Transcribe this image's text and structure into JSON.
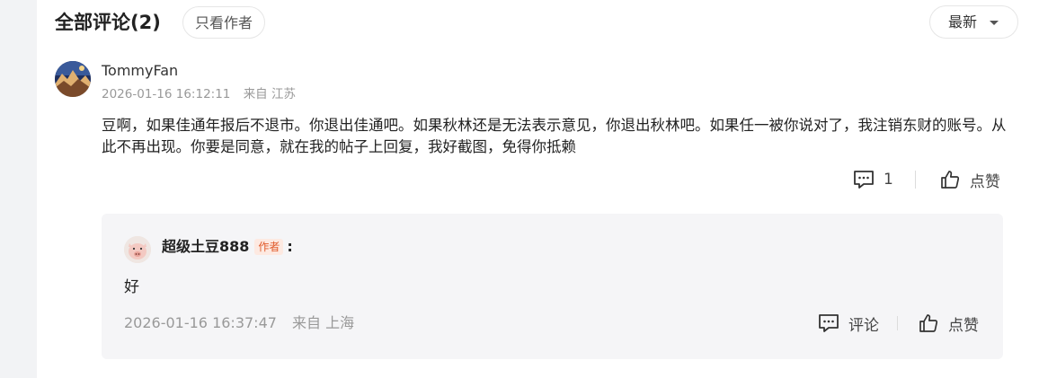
{
  "header": {
    "title": "全部评论(2)",
    "filter_label": "只看作者",
    "sort_label": "最新"
  },
  "comment": {
    "username": "TommyFan",
    "time": "2026-01-16 16:12:11",
    "location": "来自 江苏",
    "text": "豆啊，如果佳通年报后不退市。你退出佳通吧。如果秋林还是无法表示意见，你退出秋林吧。如果任一被你说对了，我注销东财的账号。从此不再出现。你要是同意，就在我的帖子上回复，我好截图，免得你抵赖",
    "reply_count": "1",
    "like_label": "点赞"
  },
  "reply": {
    "author": "超级土豆888",
    "badge": "作者",
    "colon": ":",
    "text": "好",
    "time": "2026-01-16 16:37:47",
    "location": "来自 上海",
    "comment_label": "评论",
    "like_label": "点赞"
  },
  "icons": {
    "comment": "comment-bubble-icon",
    "like": "thumbs-up-icon",
    "sort": "caret-down-icon"
  }
}
